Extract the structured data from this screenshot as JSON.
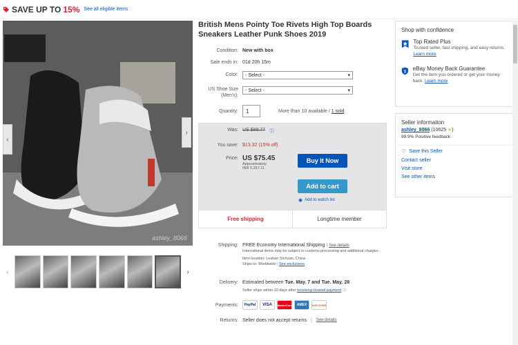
{
  "banner": {
    "text": "SAVE UP TO",
    "percent": "15%",
    "link": "See all eligible items"
  },
  "listing": {
    "title": "British Mens Pointy Toe Rivets High Top Boards Sneakers Leather Punk Shoes 2019",
    "watermark": "ashley_8066",
    "condition_label": "Condition:",
    "condition_value": "New with box",
    "sale_ends_label": "Sale ends in:",
    "sale_ends_value": "01d 20h 15m",
    "color_label": "Color:",
    "color_value": "- Select -",
    "size_label": "US Shoe Size (Men's):",
    "size_value": "- Select -",
    "quantity_label": "Quantity:",
    "quantity_value": "1",
    "available": "More than 10 available /",
    "sold": "1 sold"
  },
  "price": {
    "was_label": "Was:",
    "was_value": "US $88.77",
    "save_label": "You save:",
    "save_value": "$13.32 (15% off)",
    "price_label": "Price:",
    "price_value": "US $75.45",
    "approx": "Approximately",
    "inr": "INR 5,257.11",
    "buy_now": "Buy It Now",
    "add_to_cart": "Add to cart",
    "watch": "Add to watch list",
    "free_shipping": "Free shipping",
    "longtime": "Longtime member"
  },
  "shipping": {
    "label": "Shipping:",
    "value": "FREE  Economy International Shipping",
    "see_details": "See details",
    "note": "International items may be subject to customs processing and additional charges.",
    "location": "Item location:  Leshan Sichuan, China",
    "ships_to": "Ships to:  Worldwide",
    "exclusions": "See exclusions"
  },
  "delivery": {
    "label": "Delivery:",
    "prefix": "Estimated between",
    "dates": "Tue. May. 7 and Tue. May. 28",
    "note": "Seller ships within 10 days after",
    "link": "receiving cleared payment"
  },
  "payments": {
    "label": "Payments:",
    "logos": [
      "PayPal",
      "VISA",
      "MasterCard",
      "AMEX",
      "DISCOVER"
    ]
  },
  "returns": {
    "label": "Returns:",
    "value": "Seller does not accept returns",
    "see_details": "See details"
  },
  "confidence": {
    "heading": "Shop with confidence",
    "trp_title": "Top Rated Plus",
    "trp_desc": "Trusted seller, fast shipping, and easy returns.",
    "trp_link": "Learn more",
    "mbg_title": "eBay Money Back Guarantee",
    "mbg_desc": "Get the item you ordered or get your money back.",
    "mbg_link": "Learn more"
  },
  "seller": {
    "heading": "Seller information",
    "name": "ashley_8066",
    "score": "(10625",
    "feedback": "99.9% Positive feedback",
    "save": "Save this Seller",
    "contact": "Contact seller",
    "visit": "Visit store",
    "other": "See other items"
  },
  "colors": {
    "accent": "#0654ba",
    "red": "#dd1e31",
    "cart": "#3498ca"
  }
}
